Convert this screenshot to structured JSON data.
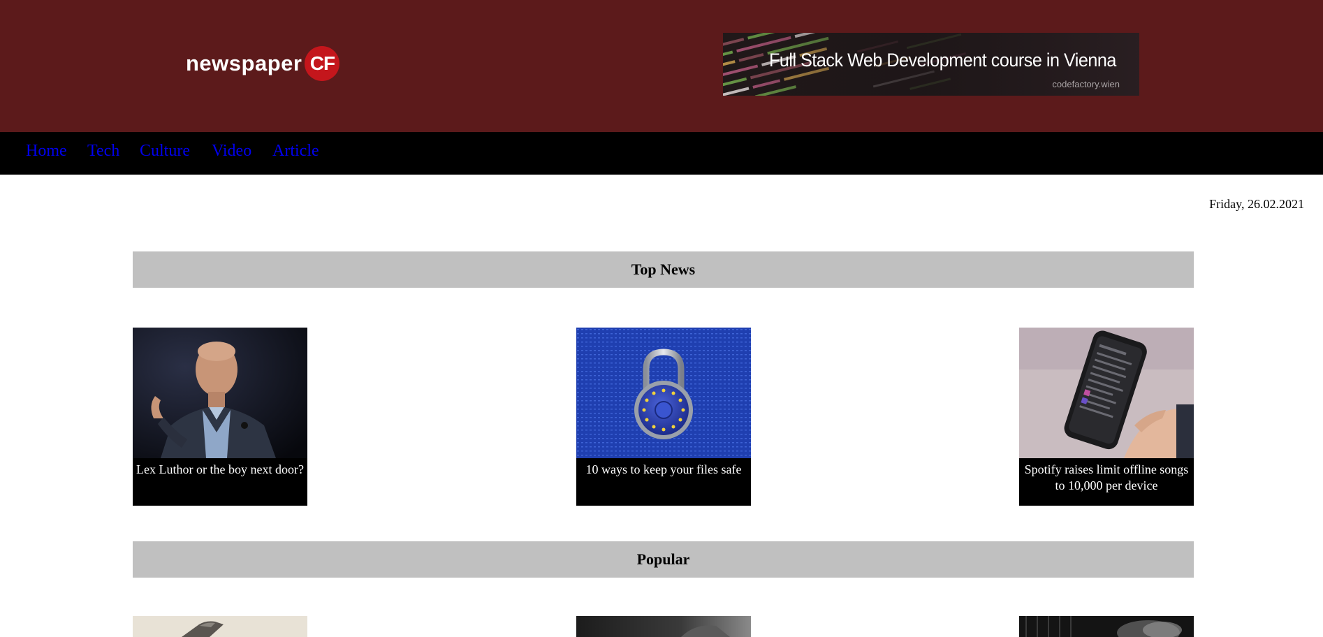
{
  "header": {
    "logo_text": "newspaper",
    "logo_badge": "CF",
    "banner": {
      "title": "Full Stack Web Development course in Vienna",
      "subtitle": "codefactory.wien"
    }
  },
  "nav": {
    "items": [
      "Home",
      "Tech",
      "Culture",
      "Video",
      "Article"
    ]
  },
  "date": "Friday, 26.02.2021",
  "sections": {
    "top_news": {
      "title": "Top News",
      "cards": [
        {
          "caption": "Lex Luthor or the boy next door?",
          "image": "man-speaking-photo"
        },
        {
          "caption": "10 ways to keep your files safe",
          "image": "eu-padlock-photo"
        },
        {
          "caption": "Spotify raises limit offline songs to 10,000 per device",
          "image": "phone-in-hand-photo"
        }
      ]
    },
    "popular": {
      "title": "Popular",
      "cards": [
        {
          "image": "device-photo"
        },
        {
          "image": "dark-gradient-photo"
        },
        {
          "image": "smoke-photo"
        }
      ]
    }
  },
  "colors": {
    "header_bg": "#5c1a1b",
    "nav_bg": "#000000",
    "nav_link": "#0000ee",
    "section_bar": "#c0c0c0",
    "logo_badge": "#c4161c"
  }
}
